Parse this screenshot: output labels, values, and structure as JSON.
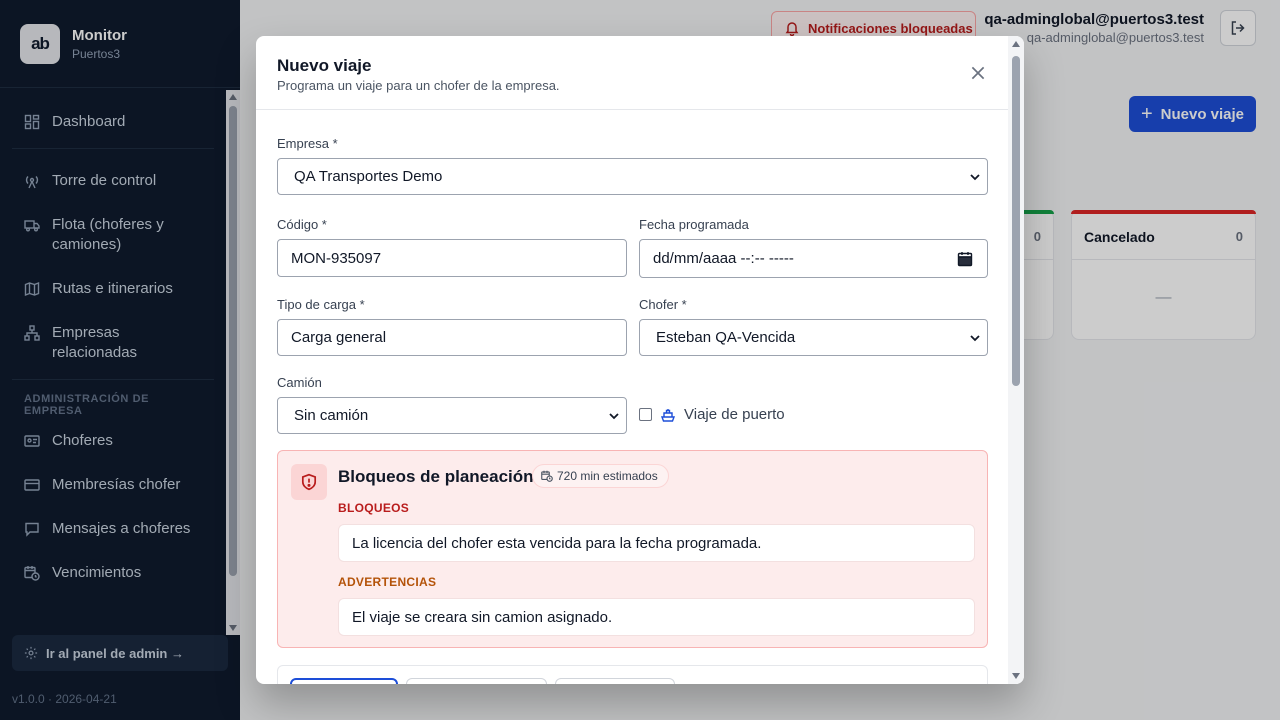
{
  "brand": {
    "logo_text": "ab",
    "title": "Monitor",
    "subtitle": "Puertos3"
  },
  "sidebar": {
    "items": [
      {
        "label": "Dashboard",
        "icon": "dashboard-icon"
      },
      {
        "label": "Torre de control",
        "icon": "radio-tower-icon"
      },
      {
        "label": "Flota (choferes y camiones)",
        "icon": "truck-icon"
      },
      {
        "label": "Rutas e itinerarios",
        "icon": "map-icon"
      },
      {
        "label": "Empresas relacionadas",
        "icon": "network-icon"
      }
    ],
    "section_title": "ADMINISTRACIÓN DE EMPRESA",
    "admin_items": [
      {
        "label": "Choferes",
        "icon": "id-card-icon"
      },
      {
        "label": "Membresías chofer",
        "icon": "credit-card-icon"
      },
      {
        "label": "Mensajes a choferes",
        "icon": "message-icon"
      },
      {
        "label": "Vencimientos",
        "icon": "calendar-clock-icon"
      }
    ],
    "admin_link": "Ir al panel de admin →",
    "version": "v1.0.0 · 2026-04-21"
  },
  "header": {
    "notifications_label": "Notificaciones bloqueadas",
    "user_name": "qa-adminglobal@puertos3.test",
    "user_email": "qa-adminglobal@puertos3.test",
    "new_trip_label": "Nuevo viaje"
  },
  "status_cards": [
    {
      "title": "",
      "count": "0",
      "color": "#16a34a"
    },
    {
      "title": "Cancelado",
      "count": "0",
      "color": "#dc2626",
      "empty": "—"
    }
  ],
  "modal": {
    "title": "Nuevo viaje",
    "subtitle": "Programa un viaje para un chofer de la empresa.",
    "fields": {
      "empresa_label": "Empresa *",
      "empresa_value": "QA Transportes Demo",
      "codigo_label": "Código *",
      "codigo_value": "MON-935097",
      "fecha_label": "Fecha programada",
      "fecha_placeholder": "dd/mm/aaaa --:-- -----",
      "tipo_label": "Tipo de carga *",
      "tipo_value": "Carga general",
      "chofer_label": "Chofer *",
      "chofer_value": "Esteban QA-Vencida",
      "camion_label": "Camión",
      "camion_value": "Sin camión",
      "puerto_label": "Viaje de puerto",
      "puerto_checked": false
    },
    "blocks": {
      "title": "Bloqueos de planeación",
      "estimate": "720 min estimados",
      "blocks_heading": "BLOQUEOS",
      "block_message": "La licencia del chofer esta vencida para la fecha programada.",
      "warnings_heading": "ADVERTENCIAS",
      "warning_message": "El viaje se creara sin camion asignado.",
      "danger_color": "#b91c1c",
      "warning_color": "#b45309"
    }
  }
}
